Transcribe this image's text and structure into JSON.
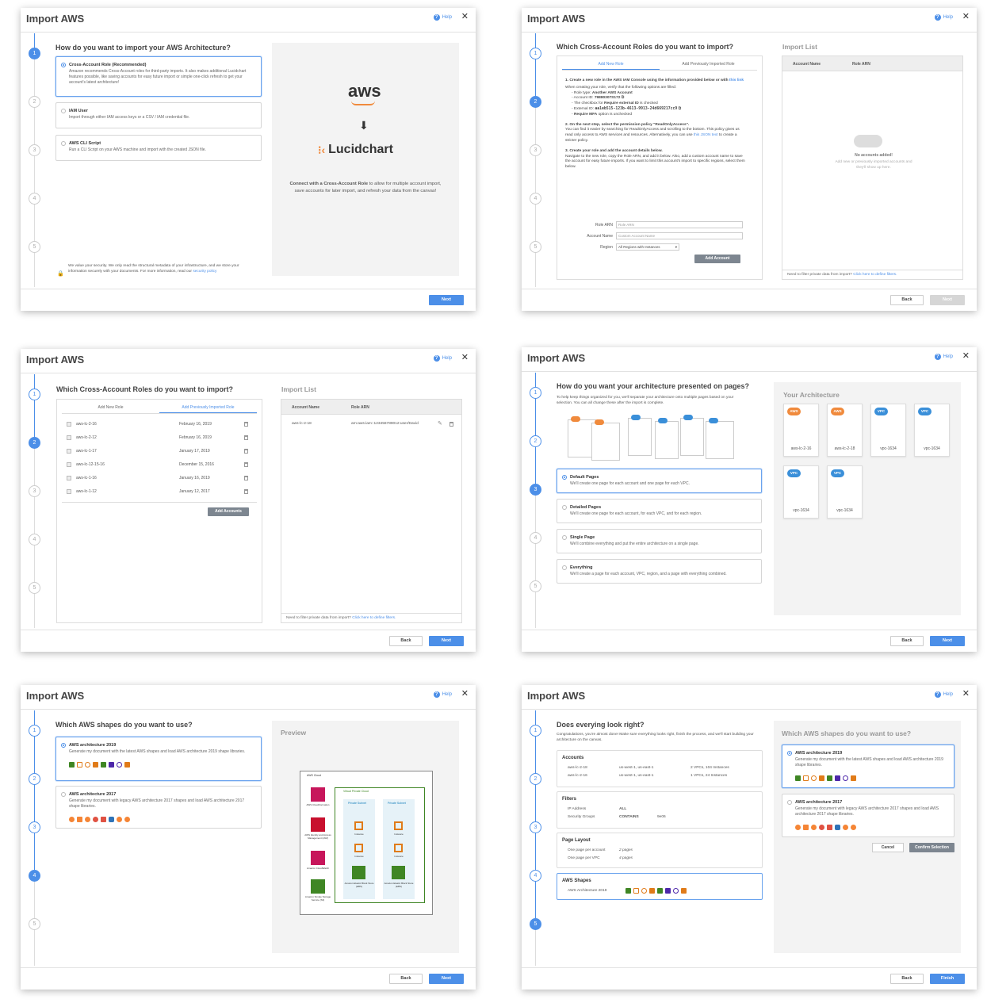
{
  "common": {
    "title": "Import AWS",
    "help": "Help",
    "close": "✕",
    "next": "Next",
    "back": "Back",
    "finish": "Finish",
    "steps": [
      "1",
      "2",
      "3",
      "4",
      "5"
    ]
  },
  "d1": {
    "question": "How do you want to import your AWS Architecture?",
    "options": [
      {
        "title": "Cross-Account Role (Recommended)",
        "desc": "Amazon recommends Cross-Account roles for third-party imports. It also makes additional Lucidchart features possible, like saving accounts for easy future import or simple one-click refresh to get your account's latest architecture!"
      },
      {
        "title": "IAM User",
        "desc": "Import through either IAM access keys or a CSV / IAM credential file."
      },
      {
        "title": "AWS CLI Script",
        "desc": "Run a CLI Script on your AWS machine and import with the created JSON file."
      }
    ],
    "security_text": "We value your security. We only read the structural metadata of your infrastructure, and we store your information securely with your documents. For more information, read our",
    "security_link": "security policy",
    "aws_logo": "aws",
    "arrow": "⬇",
    "lucid_logo": "Lucidchart",
    "connect_bold": "Connect with a Cross-Account Role",
    "connect_text": " to allow for multiple account import, save accounts for later import, and refresh your data from the canvas!"
  },
  "d2": {
    "question": "Which Cross-Account Roles do you want to import?",
    "tabs": [
      "Add New Role",
      "Add Previously Imported Role"
    ],
    "s1": "1. Create a new role in the AWS IAM Console using the information provided below or with",
    "s1_link": "this link",
    "when": "When creating your role, verify that the following options are filled:",
    "role_type_label": "- Role type:",
    "role_type": "Another AWS Account",
    "account_id_label": "- Account ID:",
    "account_id": "79880307S172",
    "checkbox_label": "- The checkbox for",
    "checkbox_val": "Require external ID",
    "checkbox_suffix": "is checked",
    "external_label": "- External ID:",
    "external_id": "aa1eb515-123b-4613-9913-24d669217cc9",
    "mfa_label": "Require MFA",
    "mfa_suffix": "option is unchecked",
    "s2": "2. On the next step, select the permission policy \"ReadOnlyAccess\".",
    "s2_text": "You can find it easier by searching for ReadOnlyAccess and scrolling to the bottom. This policy gives us read only access to AWS services and resources. Alternatively, you can use",
    "s2_link": "this JSON text",
    "s2_tail": "to create a stricter policy.",
    "s3": "3. Create your role and add the account details below.",
    "s3_text": "Navigate to the new role, copy the Role ARN, and add it below. Also, add a custom account name to save the account for easy future imports. If you want to limit this account's import to specific regions, select them below.",
    "role_arn_label": "Role ARN",
    "role_arn_ph": "Role ARN",
    "account_name_label": "Account Name",
    "account_name_ph": "Custom Account Name",
    "region_label": "Region",
    "region_val": "All Regions with Instances",
    "add_account": "Add Account",
    "import_list": "Import List",
    "col_account": "Account Name",
    "col_arn": "Role ARN",
    "empty_title": "No accounts added!",
    "empty_text": "Add new or previously imported accounts and they'll show up here.",
    "filter_text": "Need to filter private data from import?",
    "filter_link": "Click here to define filters."
  },
  "d3": {
    "question": "Which Cross-Account Roles do you want to import?",
    "tabs": [
      "Add New Role",
      "Add Previously Imported Role"
    ],
    "rows": [
      {
        "name": "aws-lc-2-16",
        "date": "February 16, 2019"
      },
      {
        "name": "aws-lc-2-12",
        "date": "February 16, 2019"
      },
      {
        "name": "aws-lc-1-17",
        "date": "January 17, 2019"
      },
      {
        "name": "aws-lc-12-15-16",
        "date": "December 15, 2016"
      },
      {
        "name": "aws-lc-1-16",
        "date": "January 16, 2019"
      },
      {
        "name": "aws-lc-1-12",
        "date": "January 12, 2017"
      }
    ],
    "add_accounts": "Add Accounts",
    "import_list": "Import List",
    "col_account": "Account Name",
    "col_arn": "Role ARN",
    "list_name": "aws-lc-2-18",
    "list_arn": "arn:aws:iam::123456789012:user/David",
    "filter_text": "Need to filter private data from import?",
    "filter_link": "Click here to define filters."
  },
  "d4": {
    "question": "How do you want your architecture presented on pages?",
    "intro": "To help keep things organized for you, we'll separate your architecture onto multiple pages based on your selection. You can all change these after the import is complete.",
    "options": [
      {
        "title": "Default Pages",
        "desc": "We'll create one page for each account and one page for each VPC."
      },
      {
        "title": "Detailed Pages",
        "desc": "We'll create one page for each account, for each VPC, and for each region."
      },
      {
        "title": "Single Page",
        "desc": "We'll combine everything and put the entire architecture on a single page."
      },
      {
        "title": "Everything",
        "desc": "We'll create a page for each account, VPC, region, and a page with everything combined."
      }
    ],
    "panel_title": "Your Architecture",
    "cards": [
      {
        "badge": "AWS",
        "label": "aws-lc-2-16"
      },
      {
        "badge": "AWS",
        "label": "aws-lc-2-18"
      },
      {
        "badge": "VPC",
        "label": "vpc-1634"
      },
      {
        "badge": "VPC",
        "label": "vpc-1634"
      },
      {
        "badge": "VPC",
        "label": "vpc-1634"
      },
      {
        "badge": "VPC",
        "label": "vpc-1634"
      }
    ]
  },
  "d5": {
    "question": "Which AWS shapes do you want to use?",
    "options": [
      {
        "title": "AWS architecture 2019",
        "desc": "Generate my document with the latest AWS shapes and load AWS architecture 2019 shape libraries."
      },
      {
        "title": "AWS architecture 2017",
        "desc": "Generate my document with legacy AWS architecture 2017 shapes and load AWS architecture 2017 shape libraries."
      }
    ],
    "preview": "Preview",
    "diagram": {
      "cloud": "AWS Cloud",
      "vpc": "Virtual Private Cloud",
      "private1": "Private Subnet",
      "private2": "Private Subnet",
      "left": [
        "AWS CloudFormation",
        "AWS Identity and Access Management (IAM)",
        "Amazon CloudWatch",
        "Amazon Simple Storage Service (S3)"
      ],
      "c1": [
        "Instance",
        "Instance",
        "Amazon Elastic Block Store (EBS)"
      ],
      "c2": [
        "Instance",
        "Instance",
        "Amazon Elastic Block Store (EBS)"
      ]
    }
  },
  "d6": {
    "question": "Does everying look right?",
    "intro": "Congratulations, you're almost done! Make sure everything looks right, finish the process, and we'll start building your architecture on the canvas.",
    "accounts_title": "Accounts",
    "accounts": [
      {
        "name": "aws-lc-2-18",
        "regions": "us-west-1, us-east-1",
        "count": "2 VPCs, 104 Instances"
      },
      {
        "name": "aws-lc-2-16",
        "regions": "us-west-1, us-east-1",
        "count": "1 VPCs, 24 Instances"
      }
    ],
    "filters_title": "Filters",
    "f1_label": "IP Address",
    "f1_op": "ALL",
    "f2_label": "Security Groups",
    "f2_op": "CONTAINS",
    "f2_val": "9e06",
    "layout_title": "Page Layout",
    "l1_label": "One page per account",
    "l1_val": "2 pages",
    "l2_label": "One page per VPC",
    "l2_val": "4 pages",
    "shapes_title": "AWS Shapes",
    "shapes_val": "AWS Architecture 2019",
    "right_title": "Which AWS shapes do you want to use?",
    "options": [
      {
        "title": "AWS architecture 2019",
        "desc": "Generate my document with the latest AWS shapes and load AWS architecture 2019 shape libraries."
      },
      {
        "title": "AWS architecture 2017",
        "desc": "Generate my document with legacy AWS architecture 2017 shapes and load AWS architecture 2017 shape libraries."
      }
    ],
    "cancel": "Cancel",
    "confirm": "Confirm Selection"
  },
  "colors": {
    "accent": "#4c8fe8",
    "aws_orange": "#f08a3c",
    "vpc_blue": "#3a8fd9"
  }
}
